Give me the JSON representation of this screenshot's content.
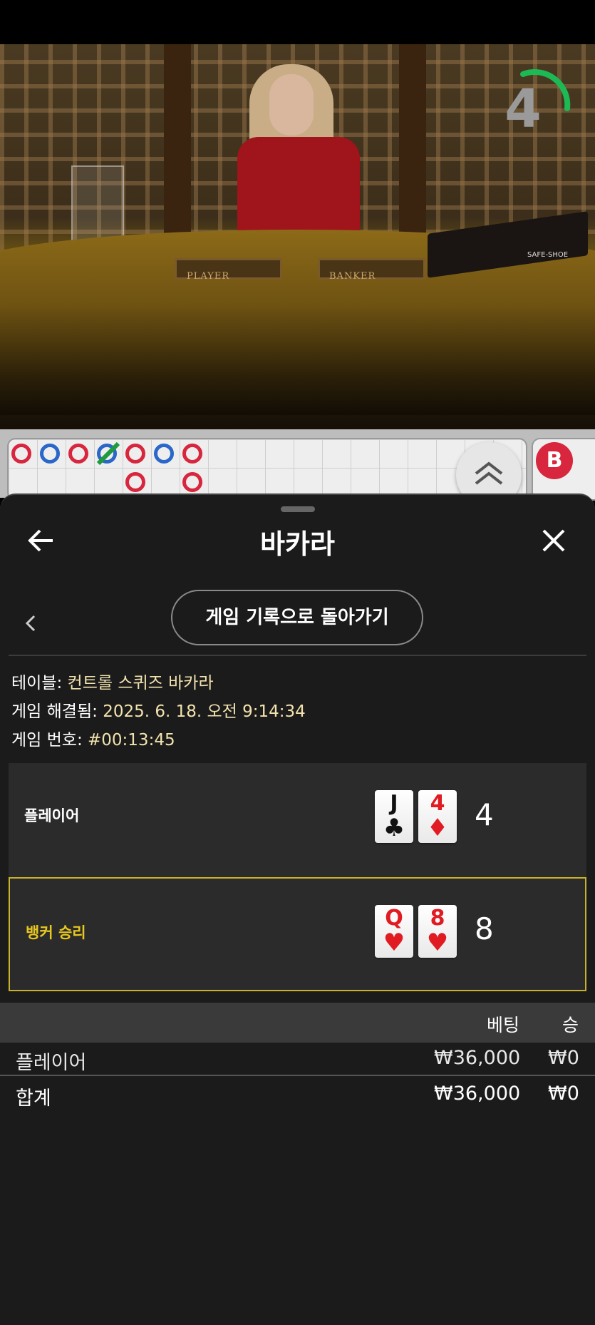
{
  "video": {
    "countdown": "4",
    "timer_progress": 0.25,
    "table_labels": {
      "player": "PLAYER",
      "banker": "BANKER"
    },
    "shoe_logo": "SAFE-SHOE"
  },
  "roadmap": {
    "bead_bubble": "B"
  },
  "panel": {
    "title": "바카라",
    "back_to_history": "게임 기록으로 돌아가기",
    "info": {
      "table_label": "테이블:",
      "table_value": "컨트롤 스퀴즈 바카라",
      "resolved_label": "게임 해결됨:",
      "resolved_value": "2025. 6. 18. 오전 9:14:34",
      "number_label": "게임 번호:",
      "number_value": "#00:13:45"
    },
    "player_hand": {
      "label": "플레이어",
      "cards": [
        {
          "rank": "J",
          "suit": "♣",
          "color": "#111111"
        },
        {
          "rank": "4",
          "suit": "♦",
          "color": "#e01b22"
        }
      ],
      "score": "4"
    },
    "banker_hand": {
      "label": "뱅커 승리",
      "cards": [
        {
          "rank": "Q",
          "suit": "♥",
          "color": "#e01b22"
        },
        {
          "rank": "8",
          "suit": "♥",
          "color": "#e01b22"
        }
      ],
      "score": "8"
    },
    "bets": {
      "headers": {
        "bet": "베팅",
        "win": "승"
      },
      "rows": [
        {
          "name": "플레이어",
          "bet": "₩36,000",
          "win": "₩0"
        }
      ],
      "total": {
        "name": "합계",
        "bet": "₩36,000",
        "win": "₩0"
      }
    },
    "colors": {
      "win_accent": "#e8c81e",
      "value_text": "#f2e3ae"
    }
  }
}
